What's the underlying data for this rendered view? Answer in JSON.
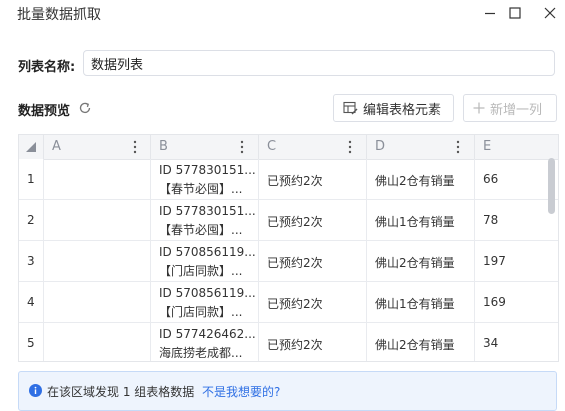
{
  "window": {
    "title": "批量数据抓取"
  },
  "list_name": {
    "label": "列表名称:",
    "value": "数据列表"
  },
  "preview": {
    "label": "数据预览",
    "edit_button": "编辑表格元素",
    "add_column_button": "新增一列"
  },
  "table": {
    "columns": [
      "A",
      "B",
      "C",
      "D",
      "E"
    ],
    "rows": [
      {
        "index": "1",
        "a": "",
        "b1": "ID 577830151...",
        "b2": "【春节必囤】...",
        "c": "已预约2次",
        "d": "佛山2仓有销量",
        "e": "66"
      },
      {
        "index": "2",
        "a": "",
        "b1": "ID 577830151...",
        "b2": "【春节必囤】...",
        "c": "已预约2次",
        "d": "佛山1仓有销量",
        "e": "78"
      },
      {
        "index": "3",
        "a": "",
        "b1": "ID 570856119...",
        "b2": "【门店同款】...",
        "c": "已预约2次",
        "d": "佛山2仓有销量",
        "e": "197"
      },
      {
        "index": "4",
        "a": "",
        "b1": "ID 570856119...",
        "b2": "【门店同款】...",
        "c": "已预约2次",
        "d": "佛山1仓有销量",
        "e": "169"
      },
      {
        "index": "5",
        "a": "",
        "b1": "ID 577426462...",
        "b2": "海底捞老成都...",
        "c": "已预约2次",
        "d": "佛山2仓有销量",
        "e": "34"
      }
    ]
  },
  "notice": {
    "text": "在该区域发现 1 组表格数据",
    "link": "不是我想要的?"
  },
  "colors": {
    "accent": "#2f6fe4",
    "notice_bg": "#eef4fd",
    "header_bg": "#f4f5f7"
  }
}
